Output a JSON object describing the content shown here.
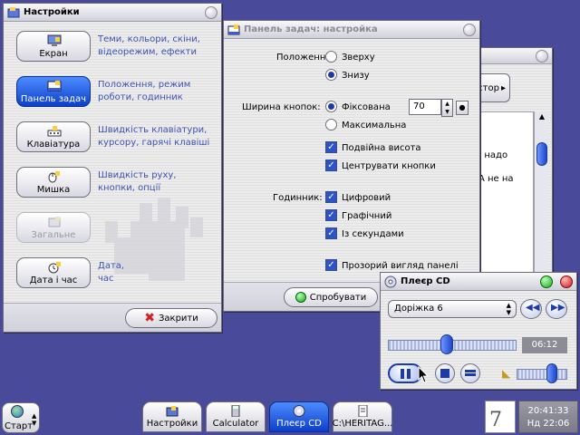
{
  "settings_window": {
    "title": "Настройки",
    "items": [
      {
        "label": "Екран",
        "desc": "Теми, кольори, скіни, відеорежим, ефекти"
      },
      {
        "label": "Панель задач",
        "desc": "Положення, режим роботи, годинник"
      },
      {
        "label": "Клавіатура",
        "desc": "Швидкість клавіатури, курсору, гарячі клавіші"
      },
      {
        "label": "Мишка",
        "desc": "Швидкість руху, кнопки, опції"
      },
      {
        "label": "Загальне",
        "desc": ""
      },
      {
        "label": "Дата і час",
        "desc": "Дата, час"
      }
    ],
    "close_label": "Закрити"
  },
  "taskbar_window": {
    "title": "Панель задач: настройка",
    "position_label": "Положення:",
    "position_top": "Зверху",
    "position_bottom": "Знизу",
    "width_label": "Ширина кнопок:",
    "width_fixed": "Фіксована",
    "width_max": "Максимальна",
    "width_value": "70",
    "double_height": "Подвійна висота",
    "center_buttons": "Центрувати кнопки",
    "clock_label": "Годинник:",
    "digital": "Цифровий",
    "graphic": "Графічний",
    "with_seconds": "Із секундами",
    "transparent": "Прозорий вигляд панелі",
    "try_label": "Спробувати"
  },
  "back_window": {
    "button_label": "стор",
    "text_line1": ", надо",
    "text_line2": "А не на"
  },
  "cd_player": {
    "title": "Плеєр CD",
    "track": "Доріжка 6",
    "time": "06:12",
    "progress": 0.45,
    "volume": 0.75
  },
  "taskbar": {
    "start_label": "Старт",
    "tasks": [
      "Настройки",
      "Calculator",
      "Плеєр CD",
      "C:\\HERITAG..."
    ],
    "clock_time": "20:41:33",
    "clock_date": "Нд 22:06",
    "calendar_day": "7"
  },
  "colors": {
    "desktop": "#4a4a9a",
    "accent": "#0d3fc8"
  }
}
